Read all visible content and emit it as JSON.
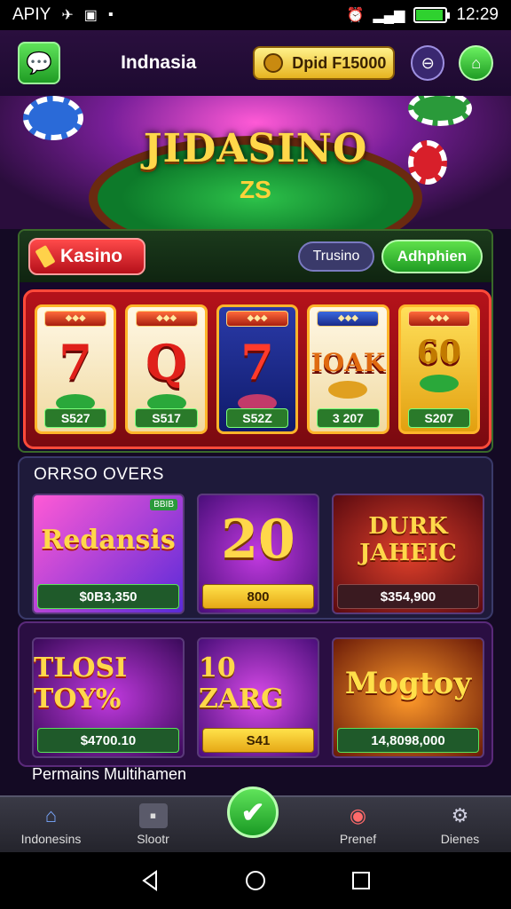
{
  "status_bar": {
    "carrier": "APIY",
    "time": "12:29"
  },
  "app_bar": {
    "region": "Indnasia",
    "balance": "Dpid F15000",
    "chat_icon": "chat-icon",
    "settings_icon": "settings-icon",
    "home_icon": "home-icon"
  },
  "hero": {
    "title": "JIDASINO",
    "emblem": "ZS"
  },
  "slot_panel": {
    "tabs": {
      "kasino": "Kasino",
      "trusino": "Trusino",
      "adhphien": "Adhphien"
    },
    "reels": [
      {
        "symbol": "7",
        "value": "S527"
      },
      {
        "symbol": "Q",
        "value": "S517"
      },
      {
        "symbol": "7",
        "value": "S52Z"
      },
      {
        "symbol": "IOAK",
        "value": "3 207"
      },
      {
        "symbol": "60",
        "value": "S207"
      }
    ]
  },
  "offers": {
    "title": "ORRSO OVERS",
    "cards": [
      {
        "name": "Redansis",
        "badge": "BBIB",
        "price": "$0B3,350"
      },
      {
        "name": "20",
        "price": "800"
      },
      {
        "name": "DURK JAHEIC",
        "price": "$354,900"
      }
    ]
  },
  "section2": {
    "cards": [
      {
        "name": "TLOSI TOY%",
        "price": "$4700.10"
      },
      {
        "name": "10 ZARG",
        "price": "S41"
      },
      {
        "name": "Mogtoy",
        "price": "14,8098,000"
      }
    ],
    "footer_label": "Permains Multihamen"
  },
  "bottom_nav": [
    {
      "label": "Indonesins",
      "icon": "house-icon"
    },
    {
      "label": "Slootr",
      "icon": "slot-icon"
    },
    {
      "label": "",
      "icon": "check-icon"
    },
    {
      "label": "Prenef",
      "icon": "target-icon"
    },
    {
      "label": "Dienes",
      "icon": "gear-icon"
    }
  ]
}
